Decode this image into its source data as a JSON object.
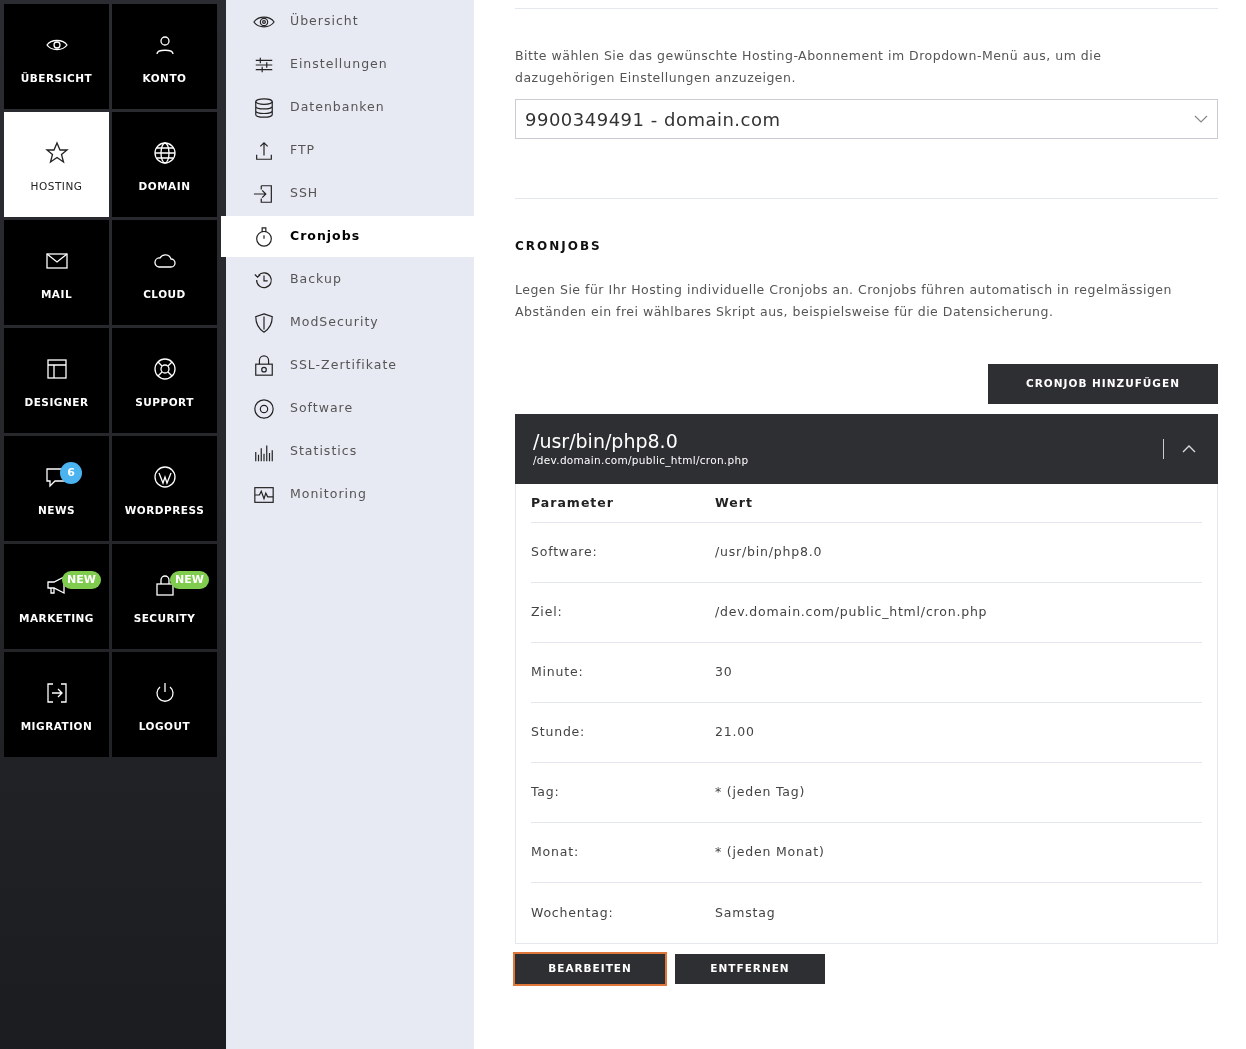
{
  "tiles": [
    {
      "label": "ÜBERSICHT",
      "selected": false
    },
    {
      "label": "KONTO",
      "selected": false
    },
    {
      "label": "HOSTING",
      "selected": true
    },
    {
      "label": "DOMAIN",
      "selected": false
    },
    {
      "label": "MAIL",
      "selected": false
    },
    {
      "label": "CLOUD",
      "selected": false
    },
    {
      "label": "DESIGNER",
      "selected": false
    },
    {
      "label": "SUPPORT",
      "selected": false
    },
    {
      "label": "NEWS",
      "selected": false,
      "badge": {
        "text": "6",
        "kind": "count"
      }
    },
    {
      "label": "WORDPRESS",
      "selected": false
    },
    {
      "label": "MARKETING",
      "selected": false,
      "badge": {
        "text": "NEW",
        "kind": "new"
      }
    },
    {
      "label": "SECURITY",
      "selected": false,
      "badge": {
        "text": "NEW",
        "kind": "new"
      }
    },
    {
      "label": "MIGRATION",
      "selected": false
    },
    {
      "label": "LOGOUT",
      "selected": false
    }
  ],
  "submenu": [
    {
      "label": "Übersicht",
      "selected": false
    },
    {
      "label": "Einstellungen",
      "selected": false
    },
    {
      "label": "Datenbanken",
      "selected": false
    },
    {
      "label": "FTP",
      "selected": false
    },
    {
      "label": "SSH",
      "selected": false
    },
    {
      "label": "Cronjobs",
      "selected": true
    },
    {
      "label": "Backup",
      "selected": false
    },
    {
      "label": "ModSecurity",
      "selected": false
    },
    {
      "label": "SSL-Zertifikate",
      "selected": false
    },
    {
      "label": "Software",
      "selected": false
    },
    {
      "label": "Statistics",
      "selected": false
    },
    {
      "label": "Monitoring",
      "selected": false
    }
  ],
  "intro": "Bitte wählen Sie das gewünschte Hosting-Abonnement im Dropdown-Menü aus, um die dazugehörigen Einstellungen anzuzeigen.",
  "subscription_select": {
    "value": "9900349491 - domain.com"
  },
  "section": {
    "title": "CRONJOBS",
    "description": "Legen Sie für Ihr Hosting individuelle Cronjobs an. Cronjobs führen automatisch in regelmässigen Abständen ein frei wählbares Skript aus, beispielsweise für die Datensicherung.",
    "add_button": "CRONJOB HINZUFÜGEN"
  },
  "cronjob": {
    "title": "/usr/bin/php8.0",
    "subtitle": "/dev.domain.com/public_html/cron.php",
    "expanded": true,
    "columns": [
      "Parameter",
      "Wert"
    ],
    "rows": [
      {
        "parameter": "Software:",
        "value": "/usr/bin/php8.0"
      },
      {
        "parameter": "Ziel:",
        "value": "/dev.domain.com/public_html/cron.php"
      },
      {
        "parameter": "Minute:",
        "value": "30"
      },
      {
        "parameter": "Stunde:",
        "value": "21.00"
      },
      {
        "parameter": "Tag:",
        "value": "* (jeden Tag)"
      },
      {
        "parameter": "Monat:",
        "value": "* (jeden Monat)"
      },
      {
        "parameter": "Wochentag:",
        "value": "Samstag"
      }
    ]
  },
  "buttons": [
    {
      "label": "BEARBEITEN",
      "focused": true
    },
    {
      "label": "ENTFERNEN",
      "focused": false
    }
  ]
}
